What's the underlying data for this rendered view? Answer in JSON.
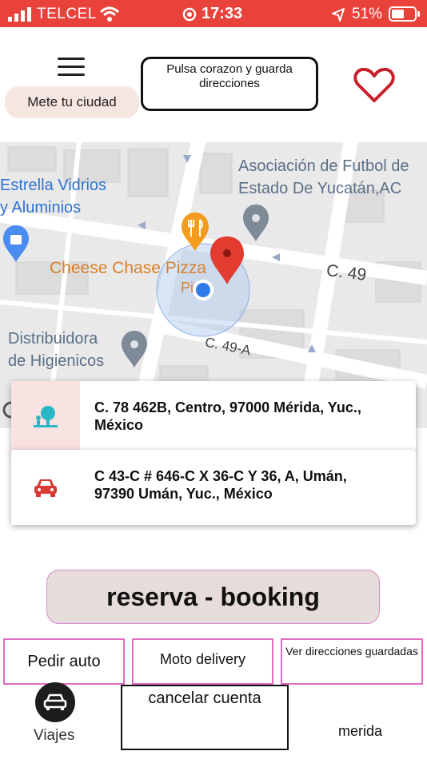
{
  "status_bar": {
    "carrier": "TELCEL",
    "time": "17:33",
    "battery": "51%"
  },
  "header": {
    "city_button": "Mete tu ciudad",
    "hint": "Pulsa corazon  y guarda direcciones"
  },
  "map": {
    "labels": {
      "asociacion_1": "Asociación de Futbol de",
      "asociacion_2": "Estado De Yucatán,AC",
      "estrella_1": "Estrella Vidrios",
      "estrella_2": "y Aluminios",
      "cheese": "Cheese Chase Pizza",
      "pi": "Pi",
      "c49": "C. 49",
      "c49a": "C. 49-A",
      "distrib_1": "Distribuidora",
      "distrib_2": "de Higienicos"
    }
  },
  "origin": {
    "address": "C. 78 462B, Centro, 97000 Mérida, Yuc., México"
  },
  "destination": {
    "address": "C 43-C # 646-C X 36-C Y 36, A, Umán, 97390 Umán, Yuc., México"
  },
  "booking_button": "reserva - booking",
  "tabs": {
    "pedir_auto": "Pedir auto",
    "moto": "Moto delivery",
    "ver_direcciones": "Ver direcciones guardadas"
  },
  "bottom": {
    "viajes": "Viajes",
    "cancelar": "cancelar cuenta",
    "city": "merida"
  },
  "colors": {
    "status_bar": "#e8423a",
    "heart": "#c8202a",
    "pill_bg": "#f6e6e2",
    "booking_bg": "#e6dcd9",
    "tab_border": "#e06cc6"
  },
  "icons": [
    "signal-icon",
    "wifi-icon",
    "alarm-icon",
    "location-arrow-icon",
    "battery-icon",
    "hamburger-menu-icon",
    "heart-icon",
    "tree-icon",
    "car-icon",
    "viajes-car-icon"
  ]
}
